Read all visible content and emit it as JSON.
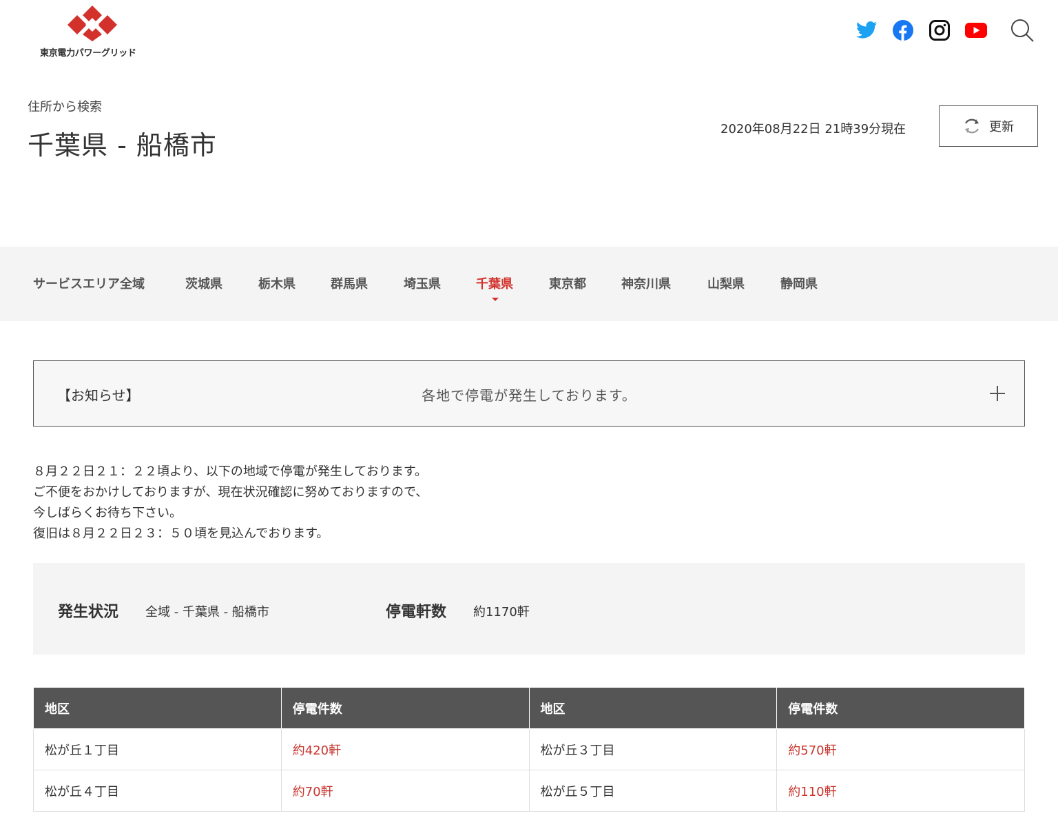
{
  "header": {
    "logo_text": "東京電力パワーグリッド",
    "brand_color": "#d3322c",
    "social_icons": [
      "twitter-icon",
      "facebook-icon",
      "instagram-icon",
      "youtube-icon"
    ],
    "search_icon": "search-icon"
  },
  "title_block": {
    "breadcrumb": "住所から検索",
    "title": "千葉県 - 船橋市",
    "timestamp": "2020年08月22日 21時39分現在",
    "refresh_label": "更新"
  },
  "prefecture_nav": {
    "items": [
      {
        "label": "サービスエリア全域"
      },
      {
        "label": "茨城県"
      },
      {
        "label": "栃木県"
      },
      {
        "label": "群馬県"
      },
      {
        "label": "埼玉県"
      },
      {
        "label": "千葉県"
      },
      {
        "label": "東京都"
      },
      {
        "label": "神奈川県"
      },
      {
        "label": "山梨県"
      },
      {
        "label": "静岡県"
      }
    ],
    "active": "千葉県",
    "active_color": "#d3322c"
  },
  "notice": {
    "label": "【お知らせ】",
    "text": "各地で停電が発生しております。"
  },
  "message": {
    "lines": [
      "８月２２日２１：２２頃より、以下の地域で停電が発生しております。",
      "ご不便をおかけしておりますが、現在状況確認に努めておりますので、",
      "今しばらくお待ち下さい。",
      "復旧は８月２２日２３：５０頃を見込んでおります。"
    ]
  },
  "status": {
    "situation_label": "発生状況",
    "situation_value": "全域 - 千葉県 - 船橋市",
    "count_label": "停電軒数",
    "count_value": "約1170軒"
  },
  "table": {
    "headers": [
      "地区",
      "停電件数",
      "地区",
      "停電件数"
    ],
    "rows": [
      [
        "松が丘１丁目",
        "約420軒",
        "松が丘３丁目",
        "約570軒"
      ],
      [
        "松が丘４丁目",
        "約70軒",
        "松が丘５丁目",
        "約110軒"
      ]
    ],
    "count_color": "#c8352e",
    "header_bg": "#555555"
  }
}
